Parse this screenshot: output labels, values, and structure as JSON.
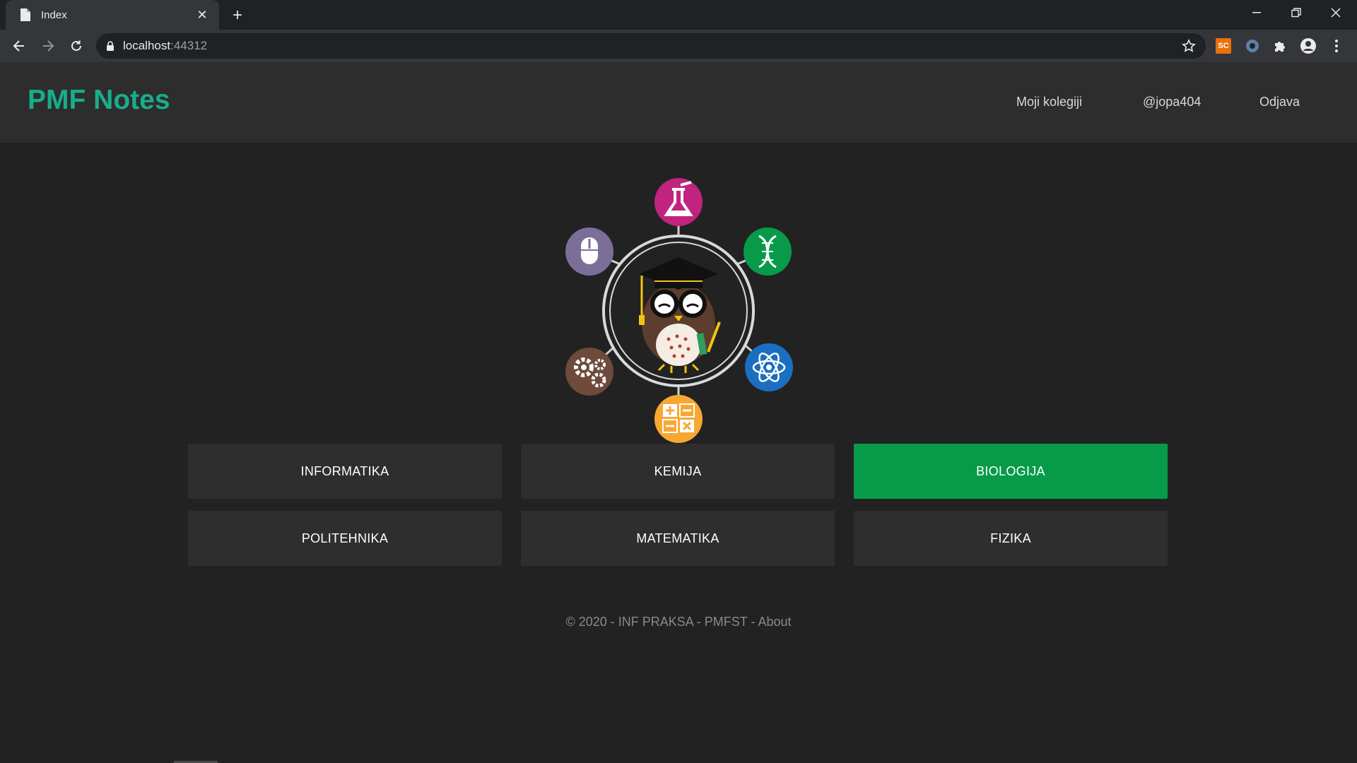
{
  "browser": {
    "tab_title": "Index",
    "url_host": "localhost",
    "url_port": ":44312",
    "ext_sc_label": "SC"
  },
  "site": {
    "brand": "PMF Notes",
    "nav": {
      "courses": "Moji kolegiji",
      "user": "@jopa404",
      "logout": "Odjava"
    }
  },
  "hero": {
    "icons": [
      "flask-icon",
      "dna-icon",
      "atom-icon",
      "calculator-icon",
      "gears-icon",
      "mouse-icon",
      "owl-graduate-icon"
    ],
    "colors": {
      "chemistry": "#c0247f",
      "biology": "#079b49",
      "physics": "#1b6fc0",
      "math": "#f7a833",
      "engineering": "#6e4a3a",
      "informatics": "#7b6f9a"
    }
  },
  "subjects": [
    {
      "label": "INFORMATIKA",
      "active": false
    },
    {
      "label": "KEMIJA",
      "active": false
    },
    {
      "label": "BIOLOGIJA",
      "active": true
    },
    {
      "label": "POLITEHNIKA",
      "active": false
    },
    {
      "label": "MATEMATIKA",
      "active": false
    },
    {
      "label": "FIZIKA",
      "active": false
    }
  ],
  "footer": {
    "text": "© 2020 - INF PRAKSA - PMFST - ",
    "about": "About"
  },
  "colors": {
    "brand": "#18ad8b",
    "active_subject": "#079b49",
    "page_bg": "#222222",
    "header_bg": "#2d2d2d"
  }
}
